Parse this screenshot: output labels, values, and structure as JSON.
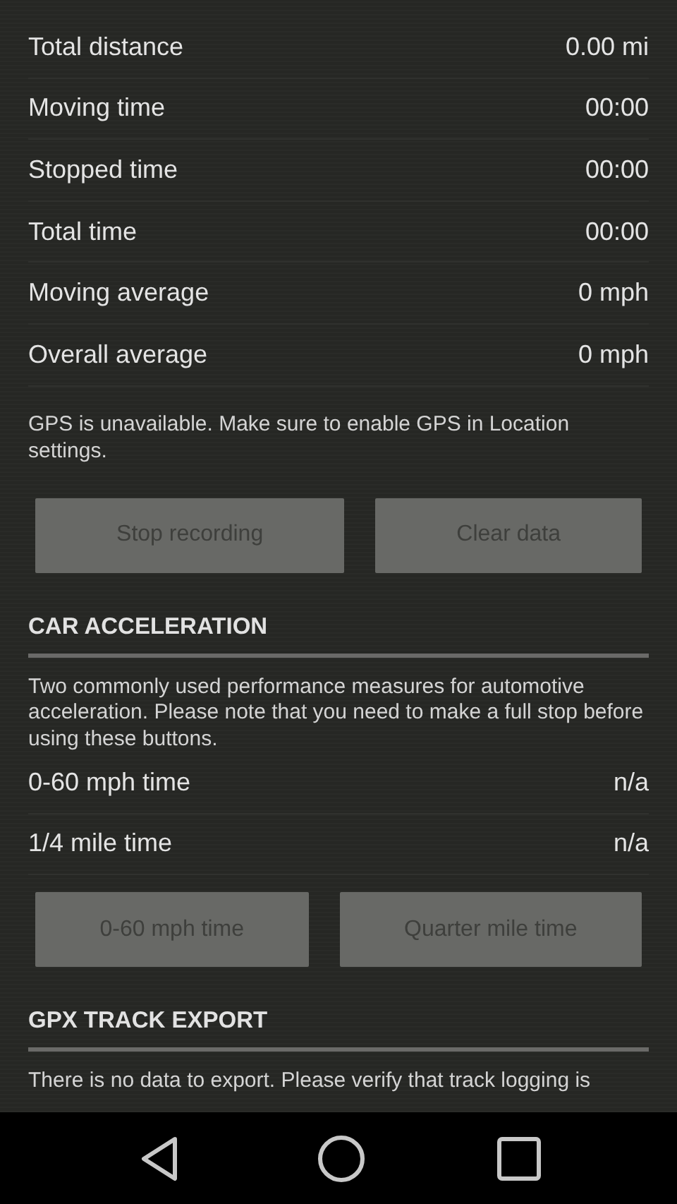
{
  "stats": [
    {
      "label": "Total distance",
      "value": "0.00 mi"
    },
    {
      "label": "Moving time",
      "value": "00:00"
    },
    {
      "label": "Stopped time",
      "value": "00:00"
    },
    {
      "label": "Total time",
      "value": "00:00"
    },
    {
      "label": "Moving average",
      "value": "0 mph"
    },
    {
      "label": "Overall average",
      "value": "0 mph"
    }
  ],
  "gps_notice": "GPS is unavailable. Make sure to enable GPS in Location settings.",
  "recording_buttons": [
    {
      "label": "Stop recording",
      "disabled": true
    },
    {
      "label": "Clear data",
      "disabled": true
    }
  ],
  "sections": [
    {
      "title": "CAR ACCELERATION",
      "description": "Two commonly used performance measures for automotive acceleration. Please note that you need to make a full stop before using these buttons.",
      "rows": [
        {
          "label": "0-60 mph time",
          "value": "n/a"
        },
        {
          "label": "1/4 mile time",
          "value": "n/a"
        }
      ],
      "buttons": [
        {
          "label": "0-60 mph time",
          "disabled": true
        },
        {
          "label": "Quarter mile time",
          "disabled": true
        }
      ]
    },
    {
      "title": "GPX TRACK EXPORT",
      "description": "There is no data to export. Please verify that track logging is"
    }
  ]
}
